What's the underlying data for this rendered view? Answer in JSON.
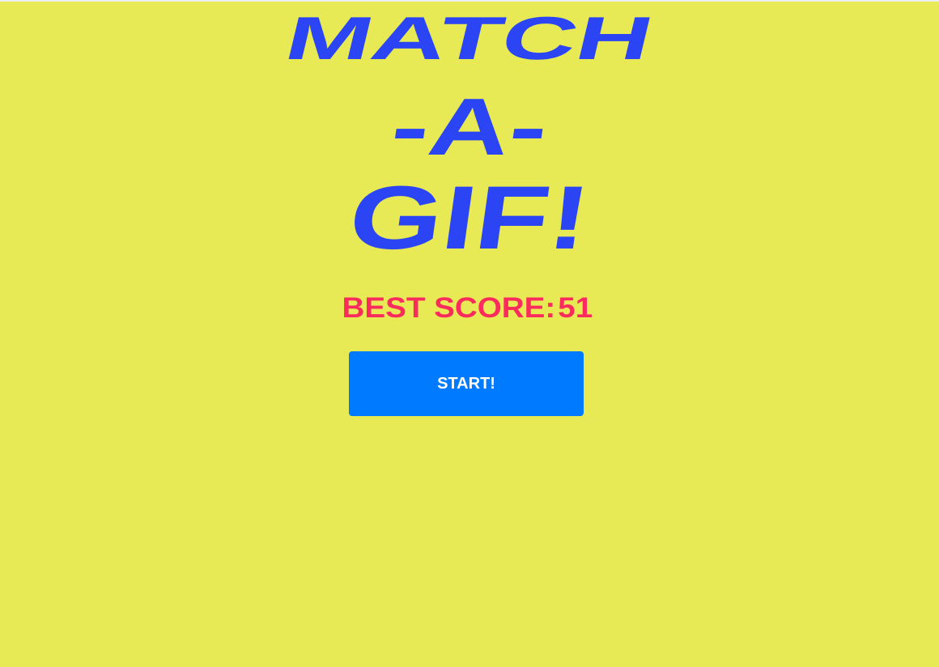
{
  "title": {
    "line1": "MATCH",
    "line2": "-A-",
    "line3": "GIF!"
  },
  "best_score": {
    "label": "BEST SCORE:",
    "value": "51"
  },
  "start_button": {
    "label": "START!"
  },
  "colors": {
    "background": "#e7ea55",
    "title": "#2b45f5",
    "score": "#fb2b5e",
    "button": "#007bff"
  }
}
